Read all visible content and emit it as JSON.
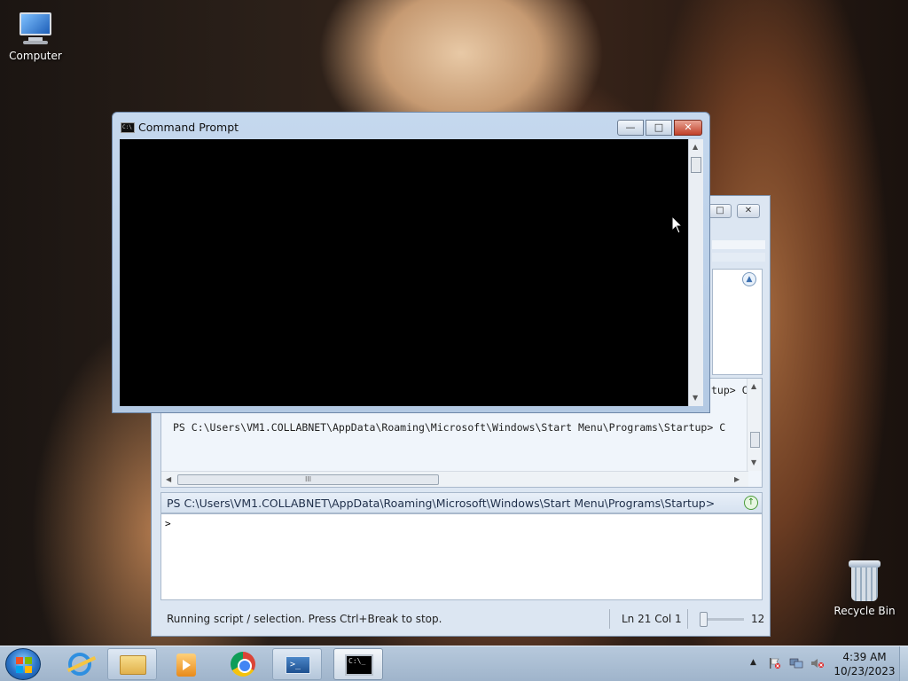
{
  "desktop": {
    "icons": [
      {
        "label": "Computer"
      },
      {
        "label": "Recycle Bin"
      }
    ]
  },
  "ise": {
    "output_lines": [
      "tup> C",
      "PS C:\\Users\\VM1.COLLABNET\\AppData\\Roaming\\Microsoft\\Windows\\Start Menu\\Programs\\Startup> C"
    ],
    "hscroll_grip": "III",
    "prompt_path": "PS C:\\Users\\VM1.COLLABNET\\AppData\\Roaming\\Microsoft\\Windows\\Start Menu\\Programs\\Startup>",
    "input_prompt": ">",
    "status_message": "Running script / selection.  Press Ctrl+Break to stop.",
    "cursor_position": "Ln 21  Col 1",
    "zoom": "12"
  },
  "cmd_window": {
    "title": "Command Prompt",
    "icon_text": "C:\\",
    "minimize": "—",
    "maximize": "□",
    "close": "✕"
  },
  "taskbar": {
    "apps": [
      {
        "name": "Internet Explorer",
        "icon": "ie-icon"
      },
      {
        "name": "Windows Explorer",
        "icon": "folder-icon"
      },
      {
        "name": "Windows Media Player",
        "icon": "media-player-icon"
      },
      {
        "name": "Google Chrome",
        "icon": "chrome-icon"
      },
      {
        "name": "Windows PowerShell ISE",
        "icon": "powershell-icon"
      },
      {
        "name": "Command Prompt",
        "icon": "cmd-icon"
      }
    ],
    "ps_icon_text": ">_",
    "cmd_icon_text": "C:\\_",
    "tray_arrow": "▲",
    "clock": {
      "time": "4:39 AM",
      "date": "10/23/2023"
    }
  }
}
